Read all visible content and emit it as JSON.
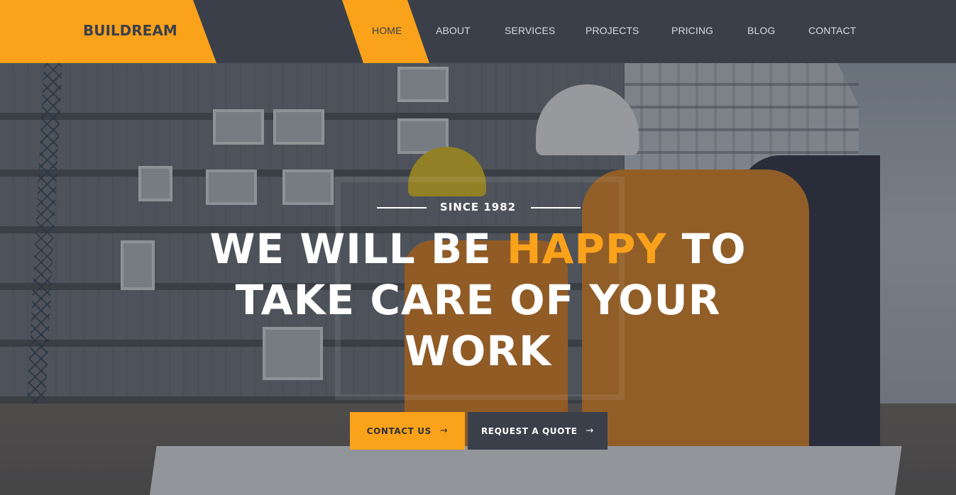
{
  "brand": {
    "logo_text": "BUILDREAM",
    "accent_color": "#fba21b",
    "dark_color": "#3a3f4a"
  },
  "nav": {
    "items": [
      {
        "label": "HOME",
        "active": true
      },
      {
        "label": "ABOUT",
        "active": false
      },
      {
        "label": "SERVICES",
        "active": false
      },
      {
        "label": "PROJECTS",
        "active": false
      },
      {
        "label": "PRICING",
        "active": false
      },
      {
        "label": "BLOG",
        "active": false
      },
      {
        "label": "CONTACT",
        "active": false
      }
    ]
  },
  "hero": {
    "since": "SINCE 1982",
    "headline_part1": "WE WILL BE ",
    "headline_highlight": "HAPPY",
    "headline_part2": " TO",
    "headline_line2": "TAKE CARE OF YOUR",
    "headline_line3": "WORK",
    "primary_button": "CONTACT US",
    "primary_button_icon": "arrow-right-icon",
    "secondary_button": "REQUEST A QUOTE",
    "secondary_button_icon": "arrow-right-icon"
  }
}
